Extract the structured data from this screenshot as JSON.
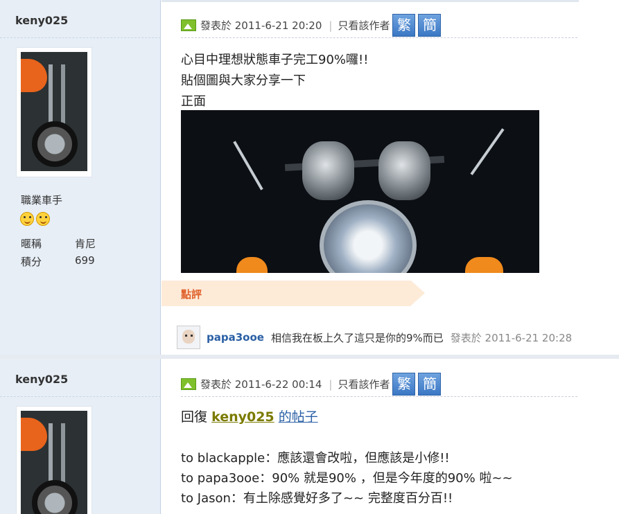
{
  "posts": [
    {
      "author": "keny025",
      "rank": "職業車手",
      "stats": [
        {
          "label": "暱稱",
          "value": "肯尼"
        },
        {
          "label": "積分",
          "value": "699"
        }
      ],
      "meta": {
        "posted": "發表於 2011-6-21 20:20",
        "only_author": "只看該作者",
        "trad_btn": "繁",
        "simp_btn": "簡"
      },
      "lines": [
        "心目中理想狀態車子完工90%囉!!",
        "貼個圖與大家分享一下",
        "正面"
      ],
      "comment_label": "點評",
      "reply": {
        "user": "papa3ooe",
        "text": "相信我在板上久了這只是你的9%而已",
        "time": "發表於 2011-6-21 20:28"
      }
    },
    {
      "author": "keny025",
      "meta": {
        "posted": "發表於 2011-6-22 00:14",
        "only_author": "只看該作者",
        "trad_btn": "繁",
        "simp_btn": "簡"
      },
      "quote_prefix": "回復",
      "quote_user": "keny025",
      "quote_suffix": "的帖子",
      "lines": [
        "to blackapple：應該還會改啦，但應該是小修!!",
        "to papa3ooe：90% 就是90% ，但是今年度的90% 啦~~",
        "to Jason：有土除感覺好多了~~ 完整度百分百!!"
      ]
    }
  ],
  "colors": {
    "sidebar": "#e7eef6",
    "comment_bg": "#fdebd8",
    "comment_text": "#e0612c",
    "link": "#2a5fa5",
    "btn": "#3b77c4"
  }
}
